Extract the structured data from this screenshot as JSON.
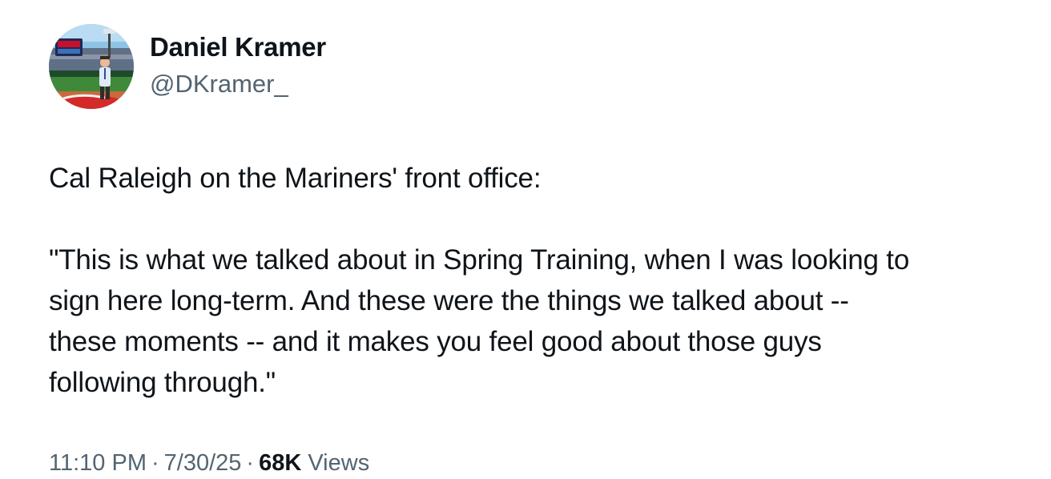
{
  "author": {
    "display_name": "Daniel Kramer",
    "handle": "@DKramer_"
  },
  "tweet": {
    "intro": "Cal Raleigh on the Mariners' front office:",
    "quote_lines": [
      "\"This is what we talked about in Spring Training, when I was looking to",
      "sign here long-term. And these were the things we talked about --",
      "these moments -- and it makes you feel good about those guys",
      "following through.\""
    ]
  },
  "meta": {
    "time": "11:10 PM",
    "separator": "·",
    "date": "7/30/25",
    "views_count": "68K",
    "views_label": "Views"
  },
  "colors": {
    "text_primary": "#0f1419",
    "text_secondary": "#536471",
    "background": "#ffffff"
  },
  "icons": {
    "avatar": "profile-photo-ballpark"
  }
}
